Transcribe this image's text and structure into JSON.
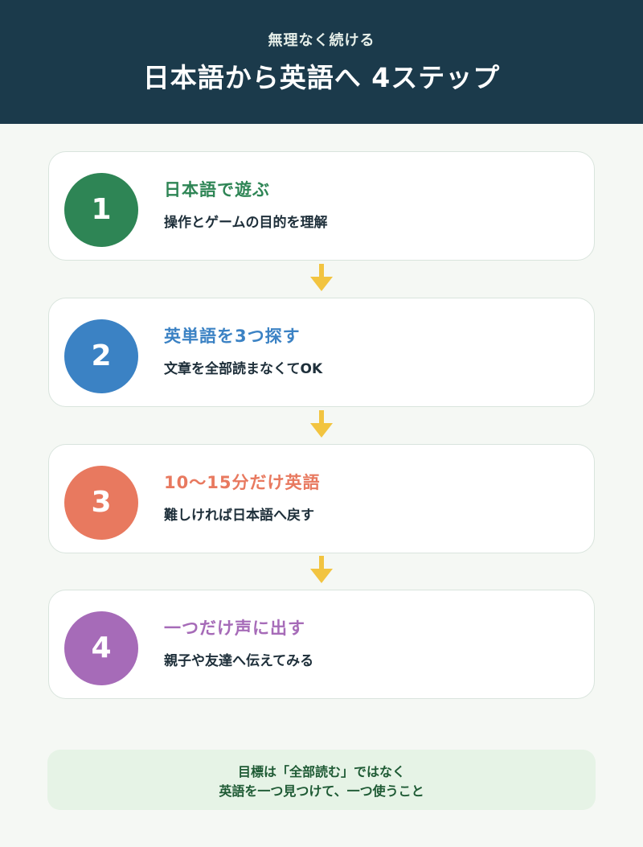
{
  "header": {
    "subtitle": "無理なく続ける",
    "title": "日本語から英語へ 4ステップ",
    "bg_color": "#1b3a4b"
  },
  "steps": [
    {
      "number": "1",
      "title": "日本語で遊ぶ",
      "description": "操作とゲームの目的を理解",
      "color": "#2e8555"
    },
    {
      "number": "2",
      "title": "英単語を3つ探す",
      "description": "文章を全部読まなくてOK",
      "color": "#3b82c4"
    },
    {
      "number": "3",
      "title": "10〜15分だけ英語",
      "description": "難しければ日本語へ戻す",
      "color": "#e8795f"
    },
    {
      "number": "4",
      "title": "一つだけ声に出す",
      "description": "親子や友達へ伝えてみる",
      "color": "#a66bb8"
    }
  ],
  "arrow_color": "#f2c440",
  "footer": {
    "line1": "目標は「全部読む」ではなく",
    "line2": "英語を一つ見つけて、一つ使うこと"
  }
}
